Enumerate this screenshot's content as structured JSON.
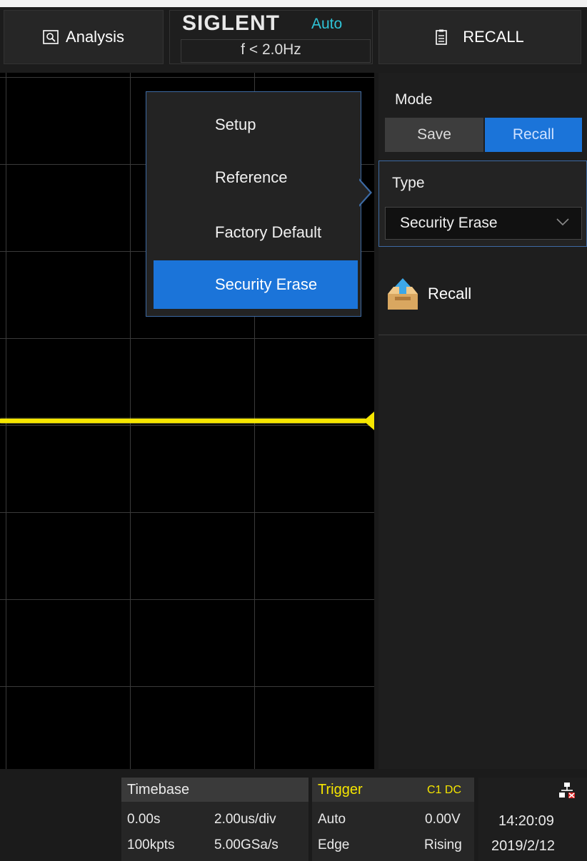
{
  "header": {
    "analysis_label": "Analysis",
    "brand": "SIGLENT",
    "trigger_mode": "Auto",
    "frequency": "f < 2.0Hz",
    "menu_title": "RECALL"
  },
  "popup_menu": {
    "items": [
      {
        "label": "Setup",
        "selected": false
      },
      {
        "label": "Reference",
        "selected": false
      },
      {
        "label": "Factory Default",
        "selected": false
      },
      {
        "label": "Security Erase",
        "selected": true
      }
    ]
  },
  "side_panel": {
    "mode_label": "Mode",
    "mode_options": [
      "Save",
      "Recall"
    ],
    "mode_selected": "Recall",
    "type_label": "Type",
    "type_value": "Security Erase",
    "recall_label": "Recall"
  },
  "status_bar": {
    "timebase": {
      "title": "Timebase",
      "delay": "0.00s",
      "scale": "2.00us/div",
      "memory_depth": "100kpts",
      "sample_rate": "5.00GSa/s"
    },
    "trigger": {
      "title": "Trigger",
      "source": "C1 DC",
      "mode": "Auto",
      "level": "0.00V",
      "type": "Edge",
      "slope": "Rising"
    },
    "clock": {
      "time": "14:20:09",
      "date": "2019/2/12"
    }
  },
  "colors": {
    "accent": "#1b74d9",
    "trace": "#f6e600",
    "auto": "#2fc3d6",
    "trigger_title": "#f6e600"
  }
}
